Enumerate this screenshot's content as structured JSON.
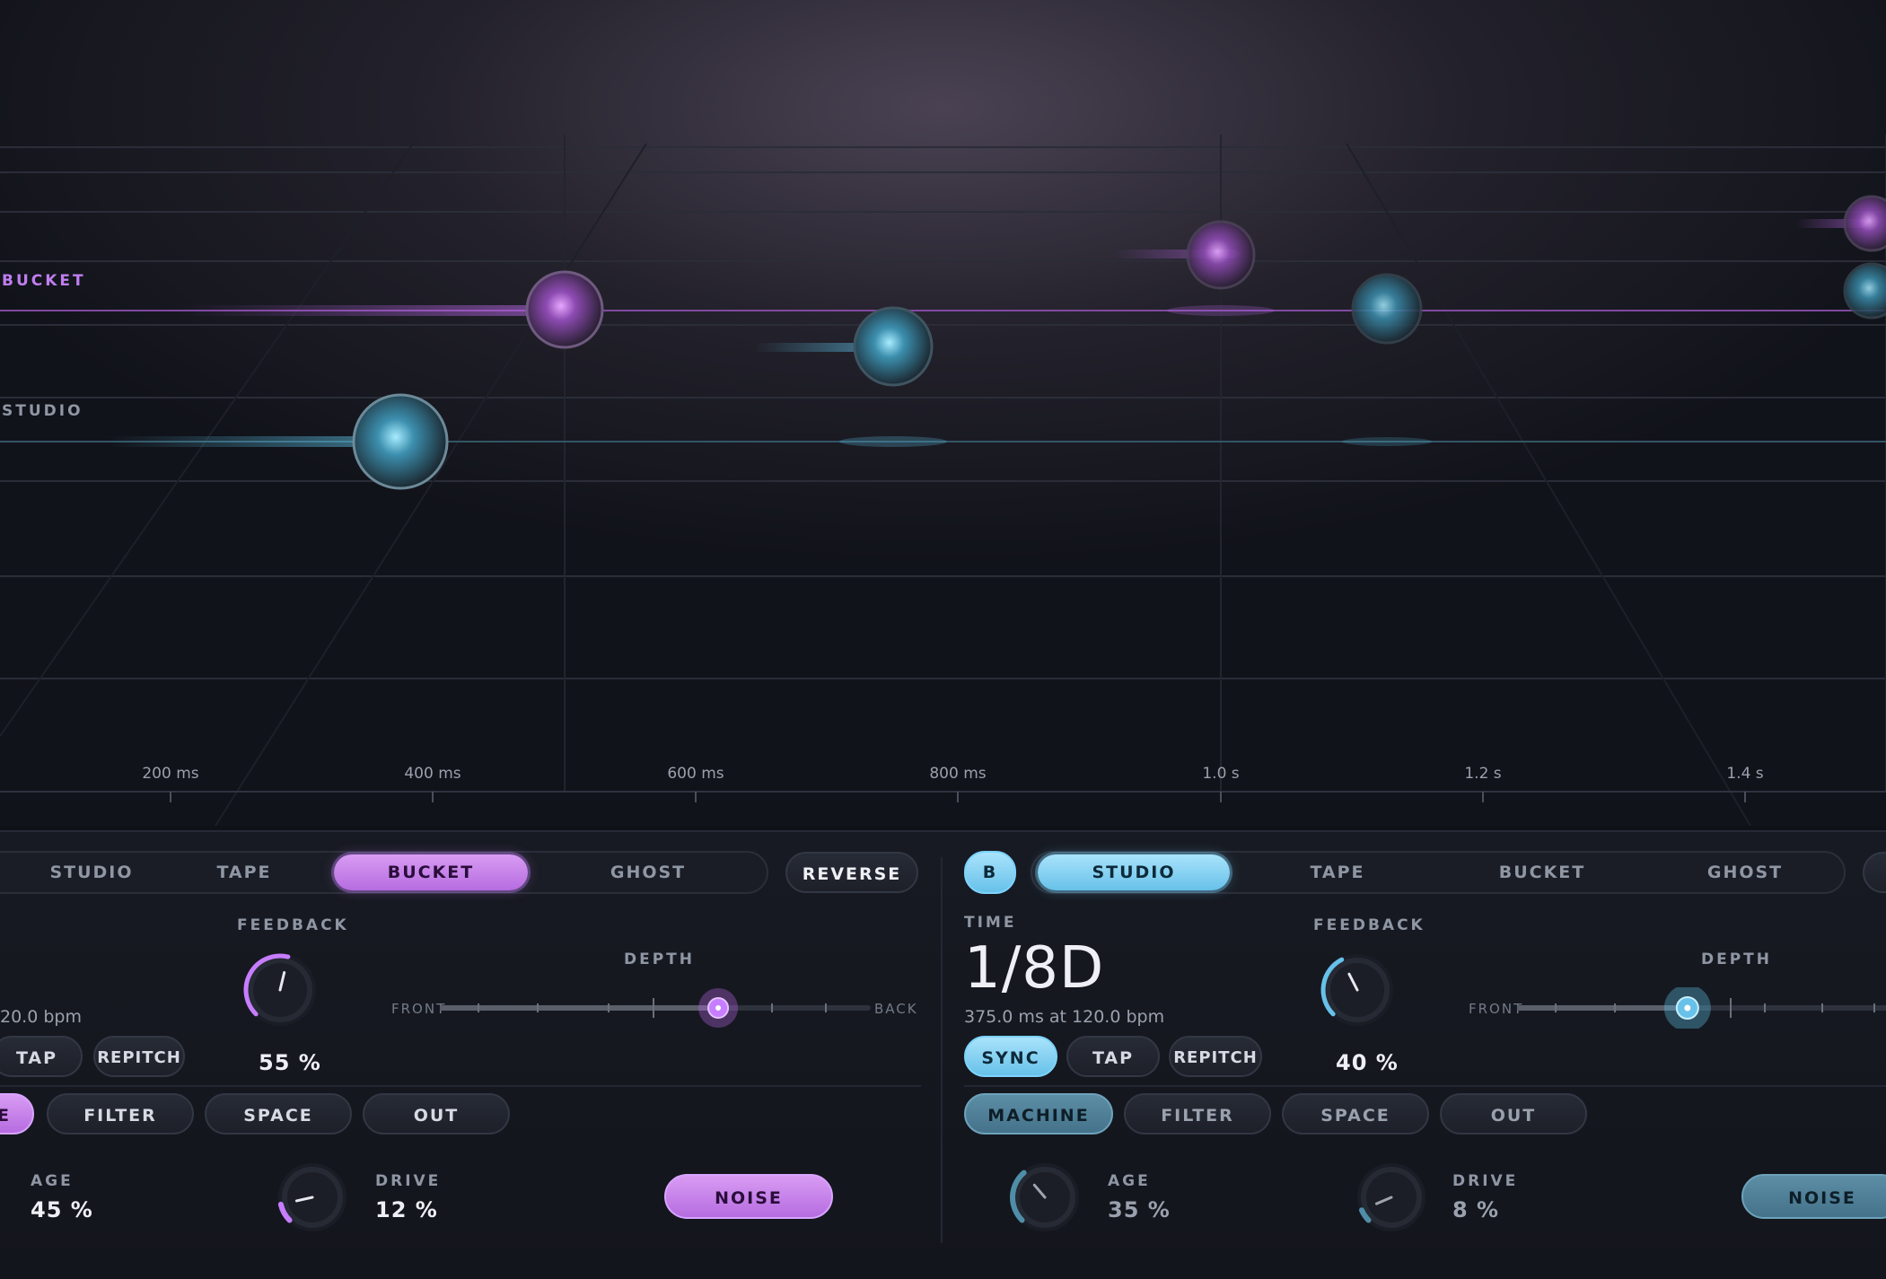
{
  "viz": {
    "lanes": {
      "bucket": "BUCKET",
      "studio": "STUDIO"
    },
    "time_ticks": [
      "200 ms",
      "400 ms",
      "600 ms",
      "800 ms",
      "1.0 s",
      "1.2 s",
      "1.4 s"
    ],
    "colors": {
      "purple": "#b866e6",
      "blue": "#5fc6ec"
    }
  },
  "left": {
    "modes": [
      "STUDIO",
      "TAPE",
      "BUCKET",
      "GHOST"
    ],
    "active_mode": "BUCKET",
    "reverse": "REVERSE",
    "bpm_partial": "20.0 bpm",
    "tap": "TAP",
    "repitch": "REPITCH",
    "feedback_label": "FEEDBACK",
    "feedback_value": "55 %",
    "feedback_level": 0.55,
    "depth_label": "DEPTH",
    "depth_front": "FRONT",
    "depth_back": "BACK",
    "depth_level": 0.65,
    "tabs": [
      "E",
      "FILTER",
      "SPACE",
      "OUT"
    ],
    "age_label": "AGE",
    "age_value": "45 %",
    "drive_label": "DRIVE",
    "drive_value": "12 %",
    "drive_level": 0.12,
    "noise": "NOISE"
  },
  "right": {
    "channel": "B",
    "modes": [
      "STUDIO",
      "TAPE",
      "BUCKET",
      "GHOST"
    ],
    "active_mode": "STUDIO",
    "time_label": "TIME",
    "time_value": "1/8D",
    "time_detail": "375.0 ms at 120.0 bpm",
    "sync": "SYNC",
    "tap": "TAP",
    "repitch": "REPITCH",
    "feedback_label": "FEEDBACK",
    "feedback_value": "40 %",
    "feedback_level": 0.4,
    "depth_label": "DEPTH",
    "depth_front": "FRONT",
    "depth_level": 0.42,
    "tabs": [
      "MACHINE",
      "FILTER",
      "SPACE",
      "OUT"
    ],
    "age_label": "AGE",
    "age_value": "35 %",
    "age_level": 0.35,
    "drive_label": "DRIVE",
    "drive_value": "8 %",
    "drive_level": 0.08,
    "noise": "NOISE"
  }
}
